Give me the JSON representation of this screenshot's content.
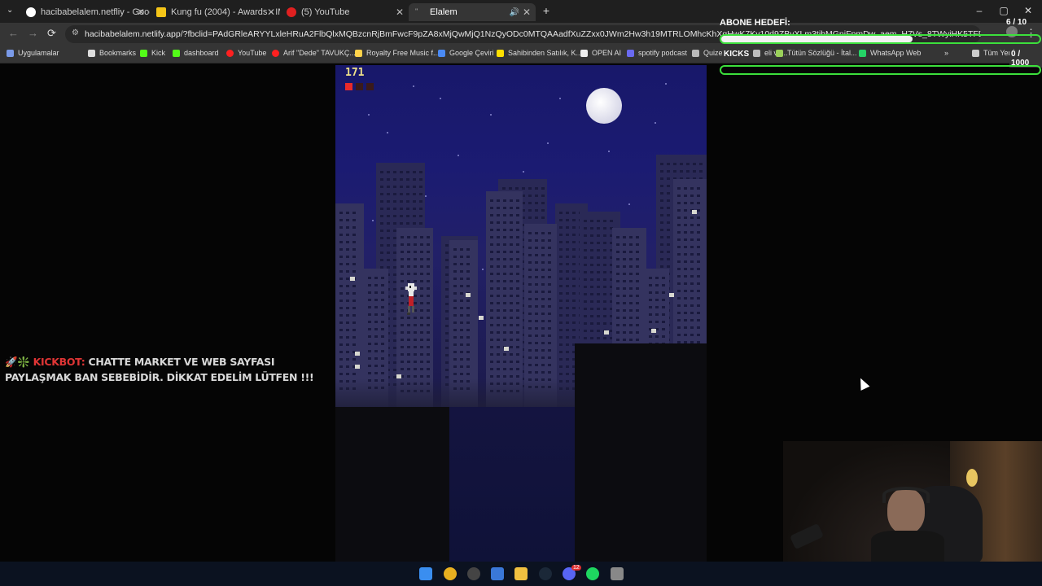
{
  "browser": {
    "tabs": [
      {
        "label": "hacibabelalem.netfliy - Google",
        "close": "✕",
        "color": "#e8e8e8"
      },
      {
        "label": "Kung fu (2004) - Awards - IMDb",
        "close": "✕",
        "color": "#f5c518"
      },
      {
        "label": "(5) YouTube",
        "close": "✕",
        "color": "#ff0000"
      },
      {
        "label": "Elalem",
        "close": "✕",
        "color": "#888888"
      }
    ],
    "new_tab": "+",
    "window_controls": {
      "minimize": "–",
      "maximize": "▢",
      "close": "✕"
    },
    "url": "hacibabelalem.netlify.app/?fbclid=PAdGRleARYYLxleHRuA2FlbQlxMQBzcnRjBmFwcF9pZA8xMjQwMjQ1NzQyODc0MTQAAadfXuZZxx0JWm2Hw3h19MTRLOMhcKhXqHwK7Kv10d9ZBvXLm3tibMGniFpmDw_aem_H7Vs_8TWyiHK5TFD2",
    "bookmarks": [
      {
        "label": "Uygulamalar",
        "icon": "apps-icon"
      },
      {
        "label": "Bookmarks",
        "icon": "star-icon"
      },
      {
        "label": "Kick",
        "icon": "kick-icon"
      },
      {
        "label": "dashboard",
        "icon": "kick-icon"
      },
      {
        "label": "YouTube",
        "icon": "youtube-icon"
      },
      {
        "label": "Arif \"Dede\" TAVUKÇ...",
        "icon": "youtube-icon"
      },
      {
        "label": "Royalty Free Music f...",
        "icon": "triangle-icon"
      },
      {
        "label": "Google Çeviri",
        "icon": "translate-icon"
      },
      {
        "label": "Sahibinden Satılık, K...",
        "icon": "s-icon"
      },
      {
        "label": "OPEN AI",
        "icon": "openai-icon"
      },
      {
        "label": "spotify podcast",
        "icon": "spotify-icon"
      },
      {
        "label": "Quizer",
        "icon": "quiz-icon"
      },
      {
        "label": "eli ve...",
        "icon": "doc-icon"
      },
      {
        "label": "Tütün Sözlüğü - İtal...",
        "icon": "leaf-icon"
      },
      {
        "label": "WhatsApp Web",
        "icon": "whatsapp-icon"
      },
      {
        "label": "Tüm Yer İmleri",
        "icon": "folder-icon"
      }
    ],
    "overflow": "»"
  },
  "game": {
    "score": "171",
    "lives": {
      "full": 1,
      "total": 3
    },
    "colors": {
      "life_full": "#e82a2a",
      "life_empty": "#3a1a1a",
      "score": "#f0e28a"
    }
  },
  "stream": {
    "abone": {
      "label": "ABONE HEDEFİ:",
      "count": "6 / 10",
      "progress": 0.6
    },
    "kicks": {
      "label": "KICKS",
      "count": "0 / 1000",
      "progress": 0
    },
    "kickbot": {
      "emojis": "🚀❇️",
      "name": "KickBot:",
      "message": "CHATTE MARKET VE WEB SAYFASI PAYLAŞMAK BAN SEBEBİDİR. DİKKAT EDELİM LÜTFEN !!!"
    }
  },
  "taskbar": {
    "apps": [
      "windows-icon",
      "chrome-icon",
      "obs-icon",
      "store-icon",
      "explorer-icon",
      "steam-icon",
      "discord-icon",
      "spotify-icon",
      "settings-icon"
    ],
    "discord_badge": "12"
  }
}
